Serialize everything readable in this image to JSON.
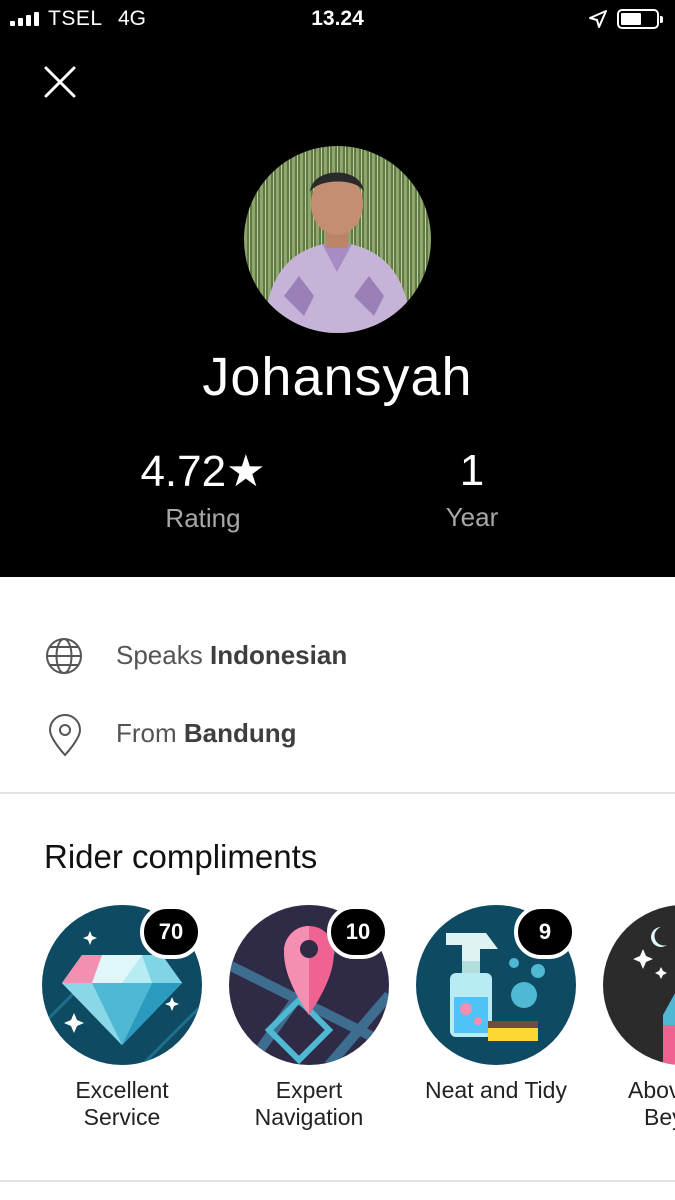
{
  "status_bar": {
    "carrier": "TSEL",
    "network": "4G",
    "time": "13.24"
  },
  "driver": {
    "name": "Johansyah"
  },
  "stats": [
    {
      "value": "4.72★",
      "label": "Rating"
    },
    {
      "value": "1",
      "label": "Year"
    }
  ],
  "info": {
    "language_prefix": "Speaks",
    "language": "Indonesian",
    "origin_prefix": "From",
    "origin": "Bandung"
  },
  "compliments": {
    "title": "Rider compliments",
    "items": [
      {
        "label_line1": "Excellent",
        "label_line2": "Service",
        "count": "70",
        "icon": "diamond-icon"
      },
      {
        "label_line1": "Expert",
        "label_line2": "Navigation",
        "count": "10",
        "icon": "map-pin-icon"
      },
      {
        "label_line1": "Neat and Tidy",
        "label_line2": "",
        "count": "9",
        "icon": "spray-bottle-icon"
      },
      {
        "label_line1": "Above and",
        "label_line2": "Beyond",
        "count": "",
        "icon": "star-night-icon"
      }
    ]
  },
  "colors": {
    "header_bg": "#000000",
    "badge_bg": "#000000",
    "teal_dark": "#0e4b63",
    "pink": "#f06292"
  }
}
